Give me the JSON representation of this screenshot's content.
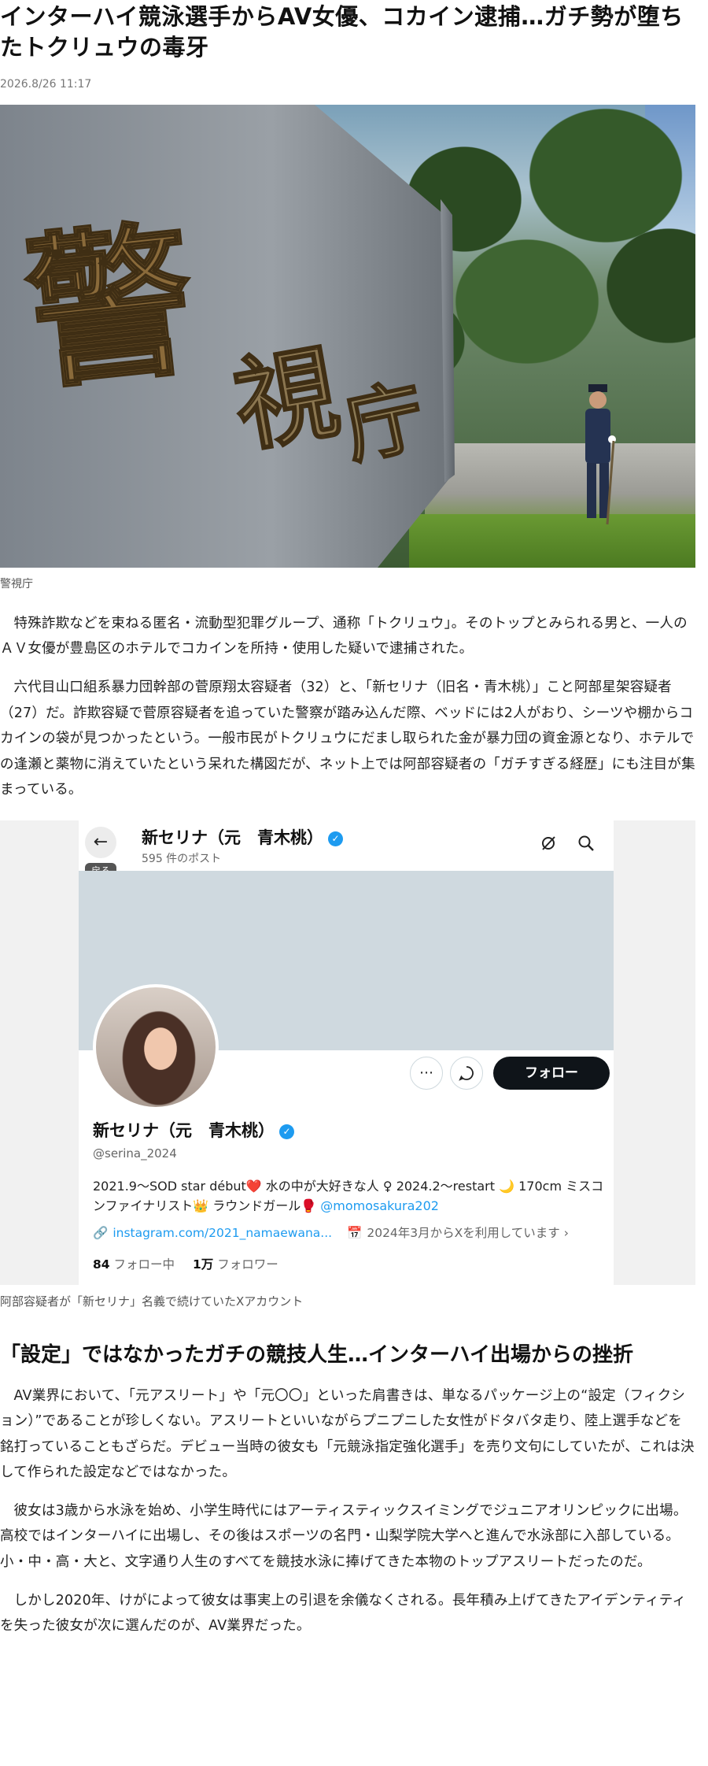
{
  "article": {
    "headline": "インターハイ競泳選手からAV女優、コカイン逮捕…ガチ勢が堕ちたトクリュウの毒牙",
    "date": "2026.8/26 11:17",
    "photo_caption": "警視庁",
    "paragraph1": "特殊詐欺などを束ねる匿名・流動型犯罪グループ、通称「トクリュウ」。そのトップとみられる男と、一人のＡＶ女優が豊島区のホテルでコカインを所持・使用した疑いで逮捕された。",
    "paragraph2": "六代目山口組系暴力団幹部の菅原翔太容疑者（32）と、「新セリナ（旧名・青木桃）」こと阿部星架容疑者（27）だ。詐欺容疑で菅原容疑者を追っていた警察が踏み込んだ際、ベッドには2人がおり、シーツや棚からコカインの袋が見つかったという。一般市民がトクリュウにだまし取られた金が暴力団の資金源となり、ホテルでの逢瀬と薬物に消えていたという呆れた構図だが、ネット上では阿部容疑者の「ガチすぎる経歴」にも注目が集まっている。",
    "embed_caption": "阿部容疑者が「新セリナ」名義で続けていたXアカウント",
    "subheading": "「設定」ではなかったガチの競技人生…インターハイ出場からの挫折",
    "paragraph3": "AV業界において、「元アスリート」や「元〇〇」といった肩書きは、単なるパッケージ上の“設定（フィクション）”であることが珍しくない。アスリートといいながらプニプニした女性がドタバタ走り、陸上選手などを銘打っていることもざらだ。デビュー当時の彼女も「元競泳指定強化選手」を売り文句にしていたが、これは決して作られた設定などではなかった。",
    "paragraph4": "彼女は3歳から水泳を始め、小学生時代にはアーティスティックスイミングでジュニアオリンピックに出場。高校ではインターハイに出場し、その後はスポーツの名門・山梨学院大学へと進んで水泳部に入部している。小・中・高・大と、文字通り人生のすべてを競技水泳に捧げてきた本物のトップアスリートだったのだ。",
    "paragraph5": "しかし2020年、けがによって彼女は事実上の引退を余儀なくされる。長年積み上げてきたアイデンティティを失った彼女が次に選んだのが、AV業界だった。"
  },
  "x_profile": {
    "back_label": "戻る",
    "display_name": "新セリナ（元　青木桃）",
    "post_count": "595 件のポスト",
    "follow_label": "フォロー",
    "handle": "@serina_2024",
    "bio": "2021.9～SOD star début❤️ 水の中が大好きな人 ♀ 2024.2～restart 🌙 170cm ミスコンファイナリスト👑 ラウンドガール🥊",
    "bio_mention": "@momosakura202",
    "link": "instagram.com/2021_namaewana...",
    "joined": "2024年3月からXを利用しています",
    "following_count": "84",
    "following_label": "フォロー中",
    "followers_count": "1万",
    "followers_label": "フォロワー",
    "accent_color": "#1d9bf0"
  },
  "icons": {
    "back": "arrow-left-icon",
    "verified": "verified-badge-icon",
    "search": "search-icon",
    "more": "more-icon",
    "message": "message-icon",
    "link": "link-icon",
    "calendar": "calendar-icon"
  }
}
